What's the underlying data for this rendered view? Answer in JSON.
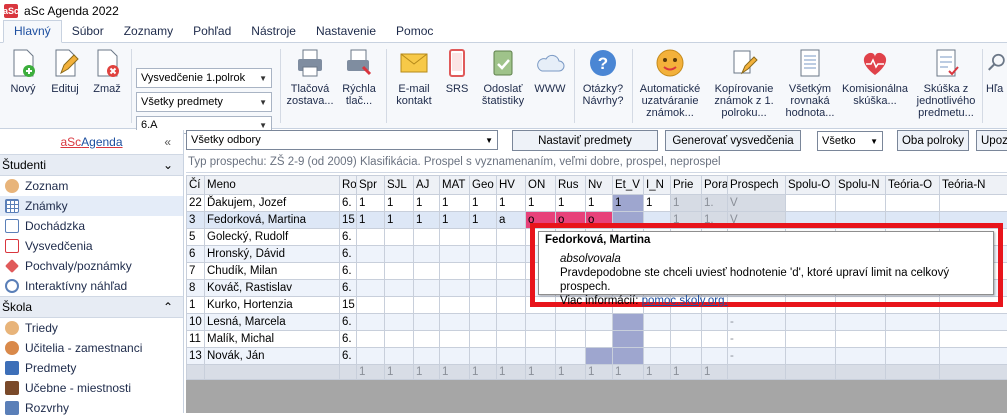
{
  "window": {
    "title": "aSc Agenda 2022",
    "icon_text": "aSc"
  },
  "menu": {
    "tabs": [
      "Hlavný",
      "Súbor",
      "Zoznamy",
      "Pohľad",
      "Nástroje",
      "Nastavenie",
      "Pomoc"
    ],
    "active": "Hlavný"
  },
  "ribbon": {
    "new": "Nový",
    "edit": "Edituj",
    "delete": "Zmaž",
    "combo_report": "Vysvedčenie 1.polrok",
    "combo_subjects": "Všetky predmety",
    "combo_class": "6.A",
    "print_set": [
      "Tlačová",
      "zostava..."
    ],
    "quick_print": [
      "Rýchla",
      "tlač..."
    ],
    "email": [
      "E-mail",
      "kontakt"
    ],
    "srs": "SRS",
    "send_stats": [
      "Odoslať",
      "štatistiky"
    ],
    "www": "WWW",
    "questions": [
      "Otázky?",
      "Návrhy?"
    ],
    "auto_close": [
      "Automatické",
      "uzatváranie",
      "známok..."
    ],
    "copy_grades": [
      "Kopírovanie",
      "známok z 1.",
      "polroku..."
    ],
    "equal_grade": [
      "Všetkým",
      "rovnaká",
      "hodnota..."
    ],
    "commission": [
      "Komisionálna",
      "skúška..."
    ],
    "exam": [
      "Skúška z",
      "jednotlivého",
      "predmetu..."
    ],
    "cut": "Hľa"
  },
  "sidebar": {
    "brand_red": "aSc",
    "brand_blue": "Agenda",
    "collapse": "«",
    "section_students": "Študenti",
    "student_items": [
      "Zoznam",
      "Známky",
      "Dochádzka",
      "Vysvedčenia",
      "Pochvaly/poznámky",
      "Interaktívny náhľad"
    ],
    "section_school": "Škola",
    "school_items": [
      "Triedy",
      "Učitelia - zamestnanci",
      "Predmety",
      "Učebne - miestnosti",
      "Rozvrhy"
    ]
  },
  "toolbar": {
    "branch_filter": "Všetky odbory",
    "set_subjects": "Nastaviť predmety",
    "generate": "Generovať vysvedčenia",
    "all_filter": "Všetko",
    "both_terms": "Oba polroky",
    "more": "Upoz"
  },
  "type_line": "Typ prospechu: ZŠ 2-9 (od 2009) Klasifikácia. Prospel s vyznamenaním, veľmi dobre, prospel, neprospel",
  "grid": {
    "headers": [
      "Čí",
      "Meno",
      "Ro",
      "Spr",
      "SJL",
      "AJ",
      "MAT",
      "Geo",
      "HV",
      "ON",
      "Rus",
      "Nv",
      "Et_V",
      "I_N",
      "Prie",
      "Pora",
      "Prospech",
      "Spolu-O",
      "Spolu-N",
      "Teória-O",
      "Teória-N"
    ],
    "rows": [
      {
        "cells": [
          "22",
          "Ďakujem, Jozef",
          "6.",
          "1",
          "1",
          "1",
          "1",
          "1",
          "1",
          "1",
          "1",
          "1",
          "1",
          "1",
          "1",
          "1.",
          "V",
          "",
          "",
          "",
          ""
        ]
      },
      {
        "cells": [
          "3",
          "Fedorková, Martina",
          "15",
          "1",
          "1",
          "1",
          "1",
          "1",
          "a",
          "o",
          "o",
          "o",
          "",
          "",
          "1",
          "1.",
          "V",
          "",
          "",
          "",
          ""
        ]
      },
      {
        "cells": [
          "5",
          "Golecký, Rudolf",
          "6.",
          "",
          "",
          "",
          "",
          "",
          "",
          "",
          "",
          "",
          "",
          "",
          "",
          "",
          "",
          "",
          "",
          "",
          ""
        ]
      },
      {
        "cells": [
          "6",
          "Hronský, Dávid",
          "6.",
          "",
          "",
          "",
          "",
          "",
          "",
          "",
          "",
          "",
          "",
          "",
          "",
          "",
          "",
          "",
          "",
          "",
          ""
        ]
      },
      {
        "cells": [
          "7",
          "Chudík, Milan",
          "6.",
          "",
          "",
          "",
          "",
          "",
          "",
          "",
          "",
          "",
          "",
          "",
          "",
          "",
          "",
          "",
          "",
          "",
          ""
        ]
      },
      {
        "cells": [
          "8",
          "Kováč, Rastislav",
          "6.",
          "",
          "",
          "",
          "",
          "",
          "",
          "",
          "",
          "",
          "",
          "",
          "",
          "",
          "",
          "",
          "",
          "",
          ""
        ]
      },
      {
        "cells": [
          "1",
          "Kurko, Hortenzia",
          "15",
          "",
          "",
          "",
          "",
          "",
          "",
          "",
          "",
          "",
          "",
          "",
          "",
          "",
          "",
          "",
          "",
          "",
          ""
        ]
      },
      {
        "cells": [
          "10",
          "Lesná, Marcela",
          "6.",
          "",
          "",
          "",
          "",
          "",
          "",
          "",
          "",
          "",
          "",
          "",
          "",
          "",
          "-",
          "",
          "",
          "",
          ""
        ]
      },
      {
        "cells": [
          "11",
          "Malík, Michal",
          "6.",
          "",
          "",
          "",
          "",
          "",
          "",
          "",
          "",
          "",
          "",
          "",
          "",
          "",
          "-",
          "",
          "",
          "",
          ""
        ]
      },
      {
        "cells": [
          "13",
          "Novák, Ján",
          "6.",
          "",
          "",
          "",
          "",
          "",
          "",
          "",
          "",
          "",
          "",
          "",
          "",
          "",
          "-",
          "",
          "",
          "",
          ""
        ]
      }
    ],
    "footer": [
      "",
      "",
      "",
      "1",
      "1",
      "1",
      "1",
      "1",
      "1",
      "1",
      "1",
      "1",
      "1",
      "1",
      "1",
      "1",
      "",
      "",
      "",
      "",
      ""
    ]
  },
  "tooltip": {
    "title": "Fedorková, Martina",
    "status": "absolvovala",
    "text": "Pravdepodobne ste chceli uviesť hodnotenie 'd', ktoré upraví limit na celkový prospech.",
    "more_label": "Viac informácií:",
    "link": "pomoc.skoly.org."
  },
  "colors": {
    "highlight": "#e7417a",
    "annotation": "#e8141b",
    "accent": "#1d4fa0"
  }
}
